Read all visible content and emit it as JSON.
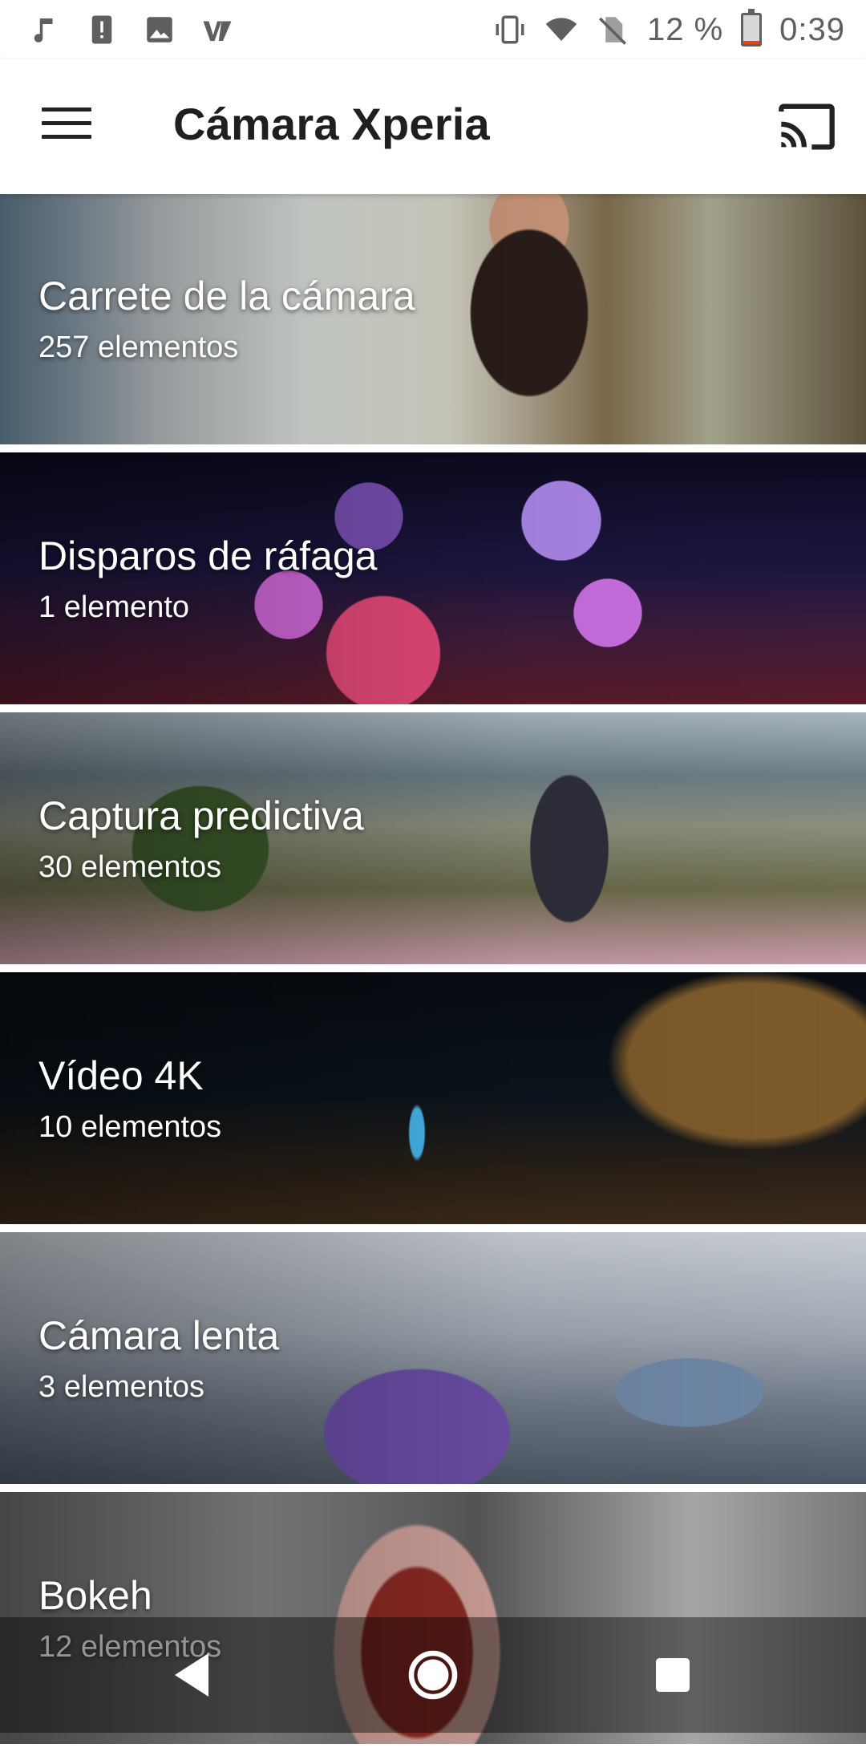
{
  "status_bar": {
    "battery_percent": "12 %",
    "time": "0:39",
    "left_icons": [
      "music-icon",
      "alert-icon",
      "image-icon",
      "carrier-icon"
    ],
    "right_icons": [
      "vibrate-icon",
      "wifi-icon",
      "no-sim-icon",
      "battery-icon"
    ],
    "battery_level": 0.12
  },
  "app_bar": {
    "title": "Cámara Xperia",
    "left_icon": "menu-icon",
    "right_icon": "cast-icon"
  },
  "albums": [
    {
      "title": "Carrete de la cámara",
      "count": "257 elementos"
    },
    {
      "title": "Disparos de ráfaga",
      "count": "1 elemento"
    },
    {
      "title": "Captura predictiva",
      "count": "30 elementos"
    },
    {
      "title": "Vídeo 4K",
      "count": "10 elementos"
    },
    {
      "title": "Cámara lenta",
      "count": "3 elementos"
    },
    {
      "title": "Bokeh",
      "count": "12 elementos"
    }
  ],
  "nav_bar": {
    "buttons": [
      "back-icon",
      "home-icon",
      "recents-icon"
    ]
  },
  "colors": {
    "battery_low": "#e5451d",
    "status_icon": "#5f5f5f",
    "title_text": "#1f1f1f"
  }
}
